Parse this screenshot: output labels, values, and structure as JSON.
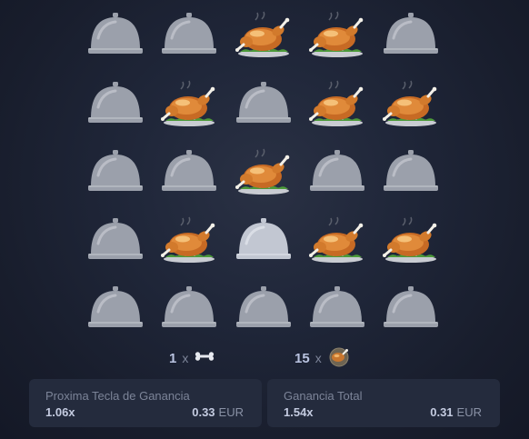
{
  "grid": {
    "rows": [
      [
        "cloche",
        "cloche",
        "chicken",
        "chicken",
        "cloche"
      ],
      [
        "cloche",
        "chicken",
        "cloche",
        "chicken",
        "chicken"
      ],
      [
        "cloche",
        "cloche",
        "chicken",
        "cloche",
        "cloche"
      ],
      [
        "cloche",
        "chicken",
        "cloche-light",
        "chicken",
        "chicken"
      ],
      [
        "cloche",
        "cloche",
        "cloche",
        "cloche",
        "cloche"
      ]
    ]
  },
  "counters": {
    "bones": {
      "count": "1",
      "x": "x",
      "icon": "bone-icon"
    },
    "chickens": {
      "count": "15",
      "x": "x",
      "icon": "roast-chicken-icon"
    }
  },
  "panels": {
    "next": {
      "title": "Proxima Tecla de Ganancia",
      "multiplier": "1.06x",
      "amount": "0.33",
      "currency": "EUR"
    },
    "total": {
      "title": "Ganancia Total",
      "multiplier": "1.54x",
      "amount": "0.31",
      "currency": "EUR"
    }
  },
  "colors": {
    "background": "#1b2030",
    "panel": "#242b3d",
    "cloche": "#9ba0ab",
    "cloche_light": "#c2c7d2",
    "chicken": "#e07a2e",
    "plate_greens": "#4c9a3a"
  }
}
